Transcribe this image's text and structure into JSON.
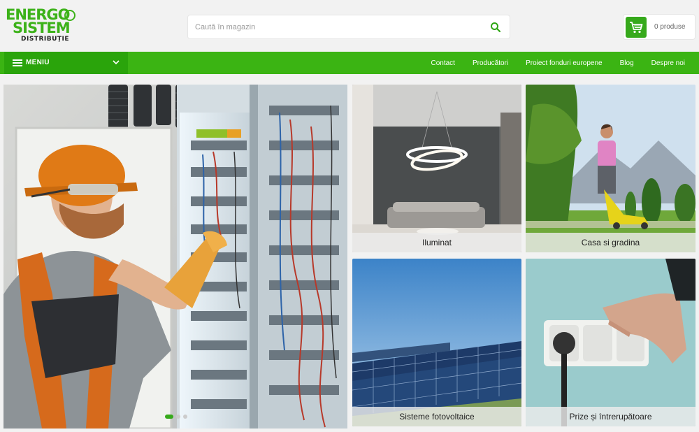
{
  "brand": {
    "line1": "ENERGO",
    "line2": "SISTEM",
    "line3": "DISTRIBUȚIE",
    "color": "#3cb219"
  },
  "search": {
    "placeholder": "Caută în magazin",
    "icon": "search-icon"
  },
  "cart": {
    "label": "0 produse",
    "icon": "cart-icon"
  },
  "nav": {
    "menu_label": "MENIU",
    "links": [
      "Contact",
      "Producători",
      "Proiect fonduri europene",
      "Blog",
      "Despre noi"
    ],
    "bar_color": "#3bb413"
  },
  "hero": {
    "slides": 3,
    "active_slide": 1
  },
  "categories": [
    {
      "label": "Iluminat"
    },
    {
      "label": "Casa si gradina"
    },
    {
      "label": "Sisteme fotovoltaice"
    },
    {
      "label": "Prize și întrerupătoare"
    }
  ]
}
